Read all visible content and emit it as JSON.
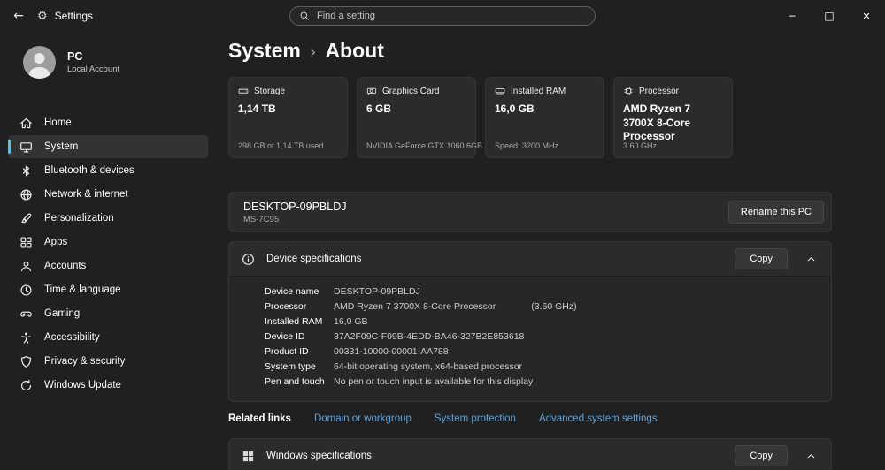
{
  "colors": {
    "accent": "#4cc2ff",
    "link": "#5ba3dd"
  },
  "titlebar": {
    "back_icon": "←",
    "gear_icon": "⚙",
    "app_name": "Settings",
    "search_placeholder": "Find a setting",
    "minimize_icon": "─",
    "maximize_icon": "□",
    "close_icon": "✕"
  },
  "sidebar": {
    "user": {
      "name": "PC",
      "subtitle": "Local Account"
    },
    "items": [
      {
        "label": "Home"
      },
      {
        "label": "System",
        "selected": true
      },
      {
        "label": "Bluetooth & devices"
      },
      {
        "label": "Network & internet"
      },
      {
        "label": "Personalization"
      },
      {
        "label": "Apps"
      },
      {
        "label": "Accounts"
      },
      {
        "label": "Time & language"
      },
      {
        "label": "Gaming"
      },
      {
        "label": "Accessibility"
      },
      {
        "label": "Privacy & security"
      },
      {
        "label": "Windows Update"
      }
    ]
  },
  "breadcrumb": {
    "root": "System",
    "separator": "›",
    "current": "About"
  },
  "cards": [
    {
      "label": "Storage",
      "value": "1,14 TB",
      "detail": "298 GB of 1,14 TB used"
    },
    {
      "label": "Graphics Card",
      "value": "6 GB",
      "detail": "NVIDIA GeForce GTX 1060 6GB"
    },
    {
      "label": "Installed RAM",
      "value": "16,0 GB",
      "detail": "Speed: 3200 MHz"
    },
    {
      "label": "Processor",
      "value": "AMD Ryzen 7 3700X 8-Core Processor",
      "detail": "3.60 GHz"
    }
  ],
  "device": {
    "name": "DESKTOP-09PBLDJ",
    "model": "MS-7C95",
    "rename_button": "Rename this PC"
  },
  "device_specs": {
    "title": "Device specifications",
    "copy_button": "Copy",
    "rows": [
      {
        "label": "Device name",
        "value": "DESKTOP-09PBLDJ"
      },
      {
        "label": "Processor",
        "value": "AMD Ryzen 7 3700X 8-Core Processor",
        "extra": "(3.60 GHz)"
      },
      {
        "label": "Installed RAM",
        "value": "16,0 GB"
      },
      {
        "label": "Device ID",
        "value": "37A2F09C-F09B-4EDD-BA46-327B2E853618"
      },
      {
        "label": "Product ID",
        "value": "00331-10000-00001-AA788"
      },
      {
        "label": "System type",
        "value": "64-bit operating system, x64-based processor"
      },
      {
        "label": "Pen and touch",
        "value": "No pen or touch input is available for this display"
      }
    ]
  },
  "related_links": {
    "title": "Related links",
    "links": [
      {
        "label": "Domain or workgroup"
      },
      {
        "label": "System protection"
      },
      {
        "label": "Advanced system settings"
      }
    ]
  },
  "windows_specs": {
    "title": "Windows specifications",
    "copy_button": "Copy"
  }
}
